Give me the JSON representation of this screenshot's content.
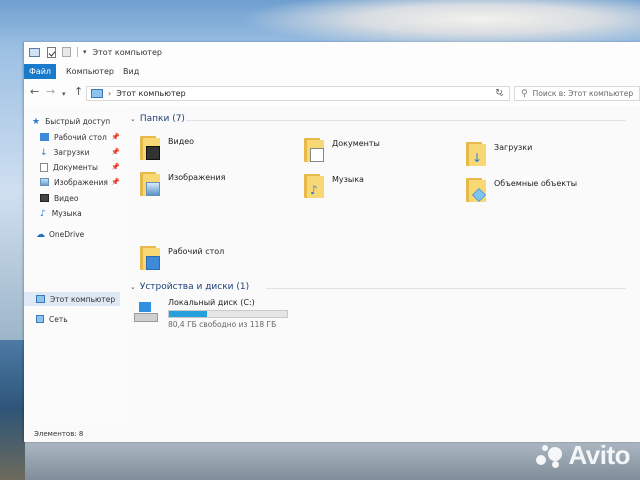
{
  "window": {
    "title": "Этот компьютер",
    "ribbon_tabs": [
      "Файл",
      "Компьютер",
      "Вид"
    ]
  },
  "addressbar": {
    "path": "Этот компьютер",
    "search_placeholder": "Поиск в: Этот компьютер"
  },
  "sidebar": {
    "items": [
      {
        "label": "Быстрый доступ",
        "icon": "star-icon"
      },
      {
        "label": "Рабочий стол",
        "icon": "desktop-icon",
        "pinned": true
      },
      {
        "label": "Загрузки",
        "icon": "download-icon",
        "pinned": true
      },
      {
        "label": "Документы",
        "icon": "document-icon",
        "pinned": true
      },
      {
        "label": "Изображения",
        "icon": "image-icon",
        "pinned": true
      },
      {
        "label": "Видео",
        "icon": "video-icon"
      },
      {
        "label": "Музыка",
        "icon": "music-icon"
      },
      {
        "label": "OneDrive",
        "icon": "cloud-icon"
      },
      {
        "label": "Этот компьютер",
        "icon": "computer-icon",
        "active": true
      },
      {
        "label": "Сеть",
        "icon": "network-icon"
      }
    ]
  },
  "main": {
    "folders_header": "Папки (7)",
    "folders": [
      {
        "label": "Видео",
        "icon": "video-folder-icon"
      },
      {
        "label": "Документы",
        "icon": "documents-folder-icon"
      },
      {
        "label": "Загрузки",
        "icon": "downloads-folder-icon"
      },
      {
        "label": "Изображения",
        "icon": "images-folder-icon"
      },
      {
        "label": "Музыка",
        "icon": "music-folder-icon"
      },
      {
        "label": "Объемные объекты",
        "icon": "3d-objects-folder-icon"
      },
      {
        "label": "Рабочий стол",
        "icon": "desktop-folder-icon"
      }
    ],
    "devices_header": "Устройства и диски (1)",
    "drive": {
      "label": "Локальный диск (C:)",
      "free_text": "80,4 ГБ свободно из 118 ГБ",
      "used_fraction": 0.32
    }
  },
  "status": {
    "items_text": "Элементов: 8"
  },
  "watermark": "Avito",
  "colors": {
    "accent": "#1979ca",
    "folder": "#f8d775",
    "drive_bar": "#26a0da"
  }
}
